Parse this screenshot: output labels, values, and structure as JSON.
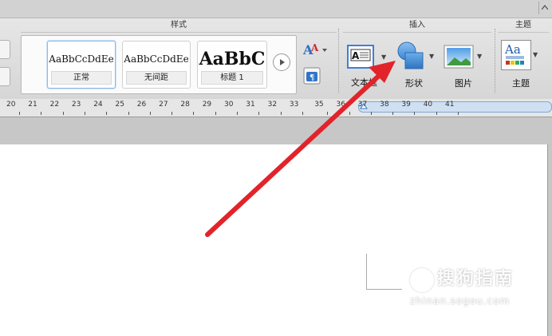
{
  "ribbon": {
    "groups": {
      "styles_title": "样式",
      "insert_title": "插入",
      "theme_title": "主题"
    },
    "style_gallery": [
      {
        "sample": "AaBbCcDdEe",
        "caption": "正常",
        "selected": true
      },
      {
        "sample": "AaBbCcDdEe",
        "caption": "无间距",
        "selected": false
      },
      {
        "sample": "AaBbC",
        "caption": "标题 1",
        "selected": false
      }
    ],
    "insert_tools": {
      "textbox_label": "文本框",
      "shapes_label": "形状",
      "picture_label": "图片"
    },
    "theme_tools": {
      "themes_label": "主题",
      "themes_icon_text": "Aa"
    }
  },
  "ruler": {
    "numbers": [
      "20",
      "21",
      "22",
      "23",
      "24",
      "25",
      "26",
      "27",
      "28",
      "29",
      "30",
      "31",
      "32",
      "33",
      "35",
      "36",
      "37",
      "38",
      "39",
      "40",
      "41"
    ]
  },
  "annotation": {
    "arrow_color": "#e2232a"
  },
  "watermark": {
    "logo_char": "S",
    "name": "搜狗指南",
    "url": "zhinan.sogou.com"
  },
  "colors": {
    "accent_blue": "#4a90d9",
    "selection_border": "#8fb8e6"
  }
}
